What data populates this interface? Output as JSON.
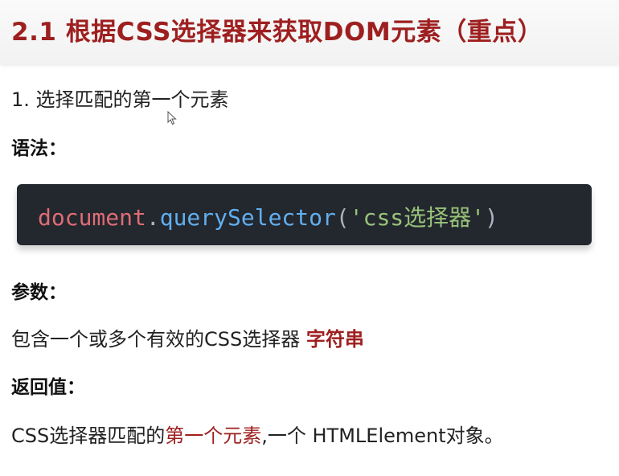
{
  "title": "2.1 根据CSS选择器来获取DOM元素（重点）",
  "item": "1. 选择匹配的第一个元素",
  "syntax_label": "语法：",
  "code": {
    "object": "document",
    "dot": ".",
    "method": "querySelector",
    "open_paren": "(",
    "argument": "'css选择器'",
    "close_paren": ")"
  },
  "params_label": "参数：",
  "params_text": {
    "before": "包含一个或多个有效的CSS选择器 ",
    "highlight": "字符串"
  },
  "return_label": "返回值：",
  "return_text": {
    "before": "CSS选择器匹配的",
    "highlight": "第一个元素",
    "after": ",一个 HTMLElement对象。"
  },
  "colors": {
    "accent_red": "#9e1f1f",
    "code_bg": "#23272e",
    "code_object": "#e06c75",
    "code_method": "#61afef",
    "code_string": "#98c379"
  },
  "icons": [
    "mouse-cursor-icon"
  ]
}
